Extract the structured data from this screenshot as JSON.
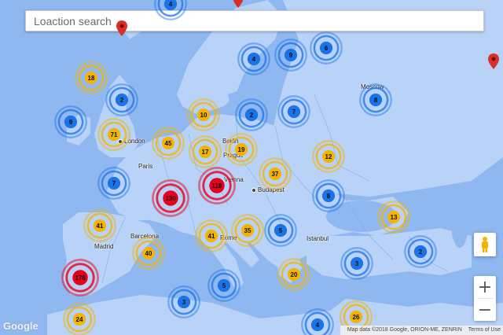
{
  "search": {
    "placeholder": "Loaction search"
  },
  "cities": [
    {
      "name": "Moscow"
    },
    {
      "name": "London"
    },
    {
      "name": "Paris"
    },
    {
      "name": "Berlin"
    },
    {
      "name": "Prague"
    },
    {
      "name": "Vienna"
    },
    {
      "name": "Budapest"
    },
    {
      "name": "Barcelona"
    },
    {
      "name": "Madrid"
    },
    {
      "name": "Rome"
    },
    {
      "name": "Istanbul"
    }
  ],
  "clusters": [
    {
      "count": "4",
      "color": "blue"
    },
    {
      "count": "9",
      "color": "blue"
    },
    {
      "count": "6",
      "color": "blue"
    },
    {
      "count": "18",
      "color": "yellow"
    },
    {
      "count": "4",
      "color": "blue"
    },
    {
      "count": "2",
      "color": "blue"
    },
    {
      "count": "8",
      "color": "blue"
    },
    {
      "count": "9",
      "color": "blue"
    },
    {
      "count": "10",
      "color": "yellow"
    },
    {
      "count": "2",
      "color": "blue"
    },
    {
      "count": "7",
      "color": "blue"
    },
    {
      "count": "71",
      "color": "yellow"
    },
    {
      "count": "45",
      "color": "yellow"
    },
    {
      "count": "17",
      "color": "yellow"
    },
    {
      "count": "19",
      "color": "yellow"
    },
    {
      "count": "12",
      "color": "yellow"
    },
    {
      "count": "37",
      "color": "yellow"
    },
    {
      "count": "7",
      "color": "blue"
    },
    {
      "count": "130",
      "color": "red"
    },
    {
      "count": "118",
      "color": "red"
    },
    {
      "count": "8",
      "color": "blue"
    },
    {
      "count": "13",
      "color": "yellow"
    },
    {
      "count": "41",
      "color": "yellow"
    },
    {
      "count": "41",
      "color": "yellow"
    },
    {
      "count": "35",
      "color": "yellow"
    },
    {
      "count": "5",
      "color": "blue"
    },
    {
      "count": "40",
      "color": "yellow"
    },
    {
      "count": "3",
      "color": "blue"
    },
    {
      "count": "2",
      "color": "blue"
    },
    {
      "count": "176",
      "color": "red"
    },
    {
      "count": "5",
      "color": "blue"
    },
    {
      "count": "20",
      "color": "yellow"
    },
    {
      "count": "3",
      "color": "blue"
    },
    {
      "count": "24",
      "color": "yellow"
    },
    {
      "count": "26",
      "color": "yellow"
    },
    {
      "count": "4",
      "color": "blue"
    }
  ],
  "pins": [
    {
      "name": "pin-a",
      "color": "#d93025"
    },
    {
      "name": "pin-b",
      "color": "#d93025"
    },
    {
      "name": "pin-c",
      "color": "#d93025"
    }
  ],
  "controls": {
    "zoom_in": "+",
    "zoom_out": "−"
  },
  "footer": {
    "logo": "Google",
    "map_data": "Map data ©2018 Google, ORION-ME, ZENRIN",
    "terms": "Terms of Use"
  },
  "colors": {
    "water": "#8fb7f0",
    "land": "#b8d3f7",
    "blue": "#1a73e8",
    "yellow": "#f6b400",
    "red": "#e8001c"
  }
}
